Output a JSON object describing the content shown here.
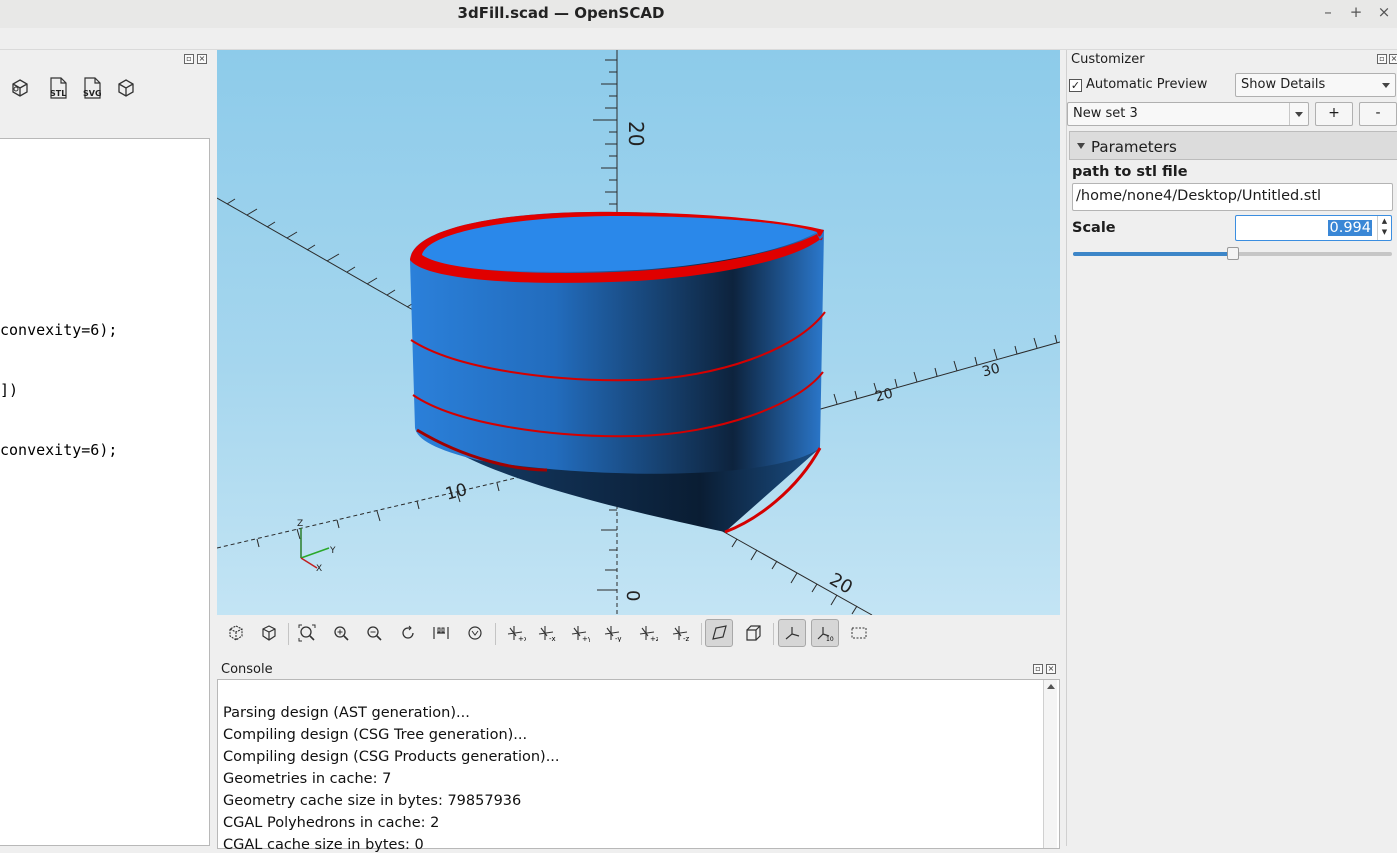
{
  "window": {
    "title": "3dFill.scad — OpenSCAD",
    "minimize": "–",
    "maximize": "+",
    "close": "×"
  },
  "editor": {
    "toolbar_icons": [
      "render-icon",
      "export-stl-icon",
      "export-svg-icon",
      "3d-print-icon"
    ],
    "stl_label": "STL",
    "svg_label": "SVG",
    "lines": [
      {
        "text": "convexity=6);"
      },
      {
        "text": "])"
      },
      {
        "text": "convexity=6);"
      }
    ]
  },
  "viewport": {
    "axis_labels": {
      "z_top": "20",
      "z_bottom": "0",
      "x_left": "10",
      "x_right_20": "20",
      "x_right_30": "30",
      "y_20": "20",
      "gizmo_z": "Z",
      "gizmo_y": "Y",
      "gizmo_x": "X"
    },
    "colors": {
      "object": "#2a7dd8",
      "object_dark": "#102a46",
      "cut_highlight": "#e00000",
      "background_top": "#8dcbea",
      "background_bottom": "#c3e4f4"
    }
  },
  "view_toolbar": {
    "buttons": [
      "preview-icon",
      "render-icon",
      "view-all-icon",
      "zoom-in-icon",
      "zoom-out-icon",
      "reset-view-icon",
      "view-center-icon",
      "view-rotate-icon",
      "view-right-icon",
      "view-left-icon",
      "view-top-icon",
      "view-bottom-icon",
      "view-front-icon",
      "view-back-icon",
      "perspective-icon",
      "orthogonal-icon",
      "show-axes-icon",
      "show-scale-markers-icon",
      "show-edges-icon"
    ]
  },
  "console": {
    "title": "Console",
    "lines": [
      "Parsing design (AST generation)...",
      "Compiling design (CSG Tree generation)...",
      "Compiling design (CSG Products generation)...",
      "Geometries in cache: 7",
      "Geometry cache size in bytes: 79857936",
      "CGAL Polyhedrons in cache: 2",
      "CGAL cache size in bytes: 0"
    ]
  },
  "customizer": {
    "title": "Customizer",
    "auto_preview_label": "Automatic Preview",
    "auto_preview_checked": true,
    "check_mark": "✓",
    "details_select": "Show Details",
    "preset_select": "New set 3",
    "add_button": "+",
    "remove_button": "-",
    "section_title": "Parameters",
    "params": [
      {
        "label": "path to stl file",
        "value": "/home/none4/Desktop/Untitled.stl"
      },
      {
        "label": "Scale",
        "value": "0.994",
        "slider_fraction": 0.5
      }
    ]
  }
}
